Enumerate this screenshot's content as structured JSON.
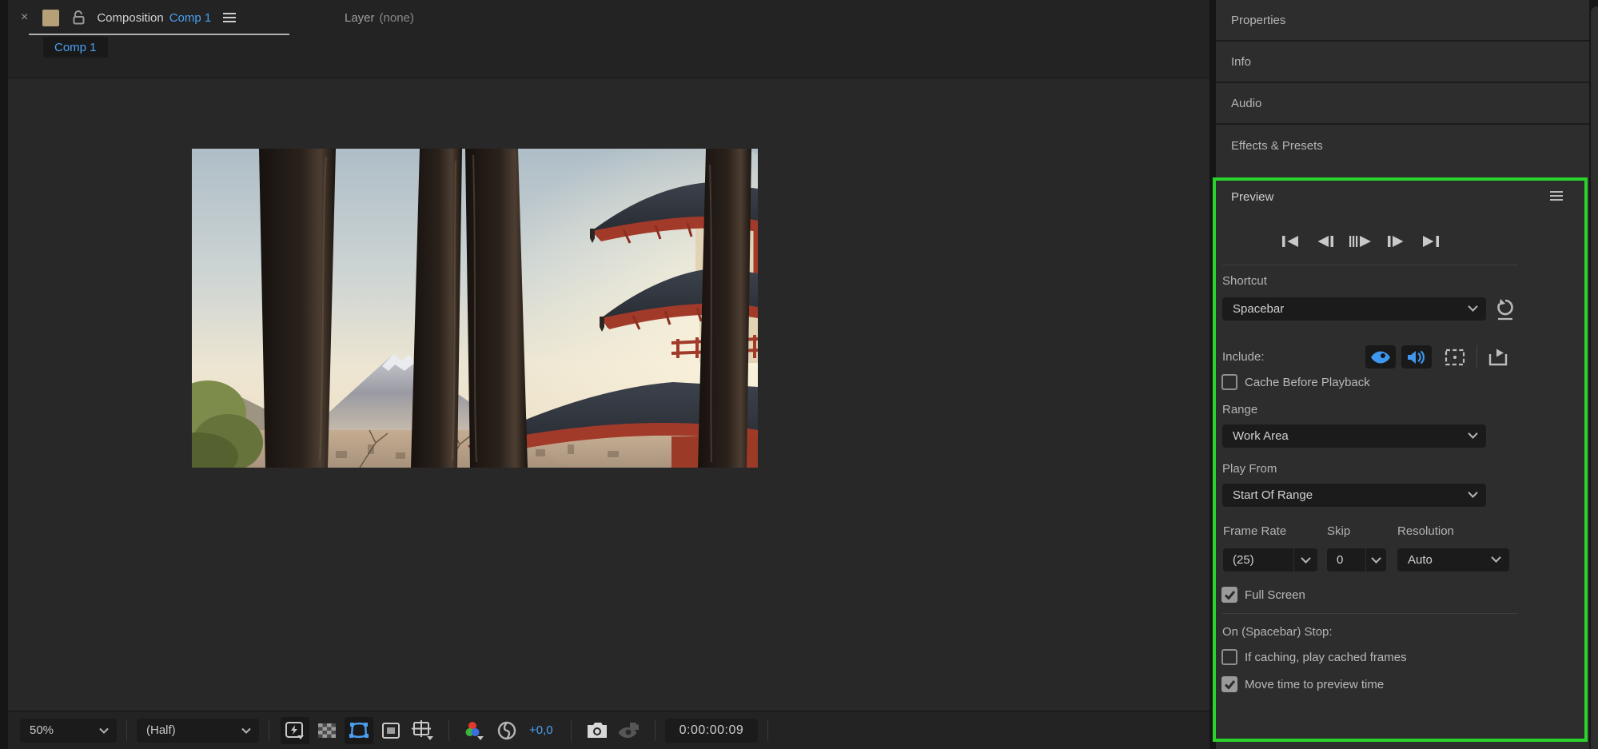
{
  "comp_panel": {
    "tabs": {
      "close_label": "×",
      "composition_tab": {
        "title": "Composition",
        "target": "Comp 1"
      },
      "layer_tab": {
        "title": "Layer",
        "target": "(none)"
      },
      "comp_button_label": "Comp 1"
    },
    "viewer": {
      "image_alt": "Red pagoda and Mount Fuji at dusk seen through dark fence slats"
    },
    "toolbar": {
      "zoom_value": "50%",
      "resolution_value": "(Half)",
      "exposure_value": "+0,0",
      "timecode": "0:00:00:09",
      "icons": [
        "fast-previews",
        "transparency-grid",
        "mask-visibility",
        "region-of-interest",
        "grid-guides",
        "channels",
        "exposure",
        "snapshot",
        "show-snapshot"
      ]
    }
  },
  "right_panel": {
    "sections": [
      {
        "label": "Properties"
      },
      {
        "label": "Info"
      },
      {
        "label": "Audio"
      },
      {
        "label": "Effects & Presets"
      }
    ],
    "preview": {
      "title": "Preview",
      "transport_icons": [
        "first-frame",
        "previous-frame",
        "play",
        "next-frame",
        "last-frame"
      ],
      "shortcut_label": "Shortcut",
      "shortcut_value": "Spacebar",
      "include_label": "Include:",
      "include_icons": [
        "video-eye",
        "audio-speaker",
        "overlays",
        "play-on-device"
      ],
      "cache_checkbox": {
        "label": "Cache Before Playback",
        "checked": false
      },
      "range_label": "Range",
      "range_value": "Work Area",
      "play_from_label": "Play From",
      "play_from_value": "Start Of Range",
      "frame_rate_label": "Frame Rate",
      "frame_rate_value": "(25)",
      "skip_label": "Skip",
      "skip_value": "0",
      "resolution_label": "Resolution",
      "resolution_value": "Auto",
      "full_screen_checkbox": {
        "label": "Full Screen",
        "checked": true
      },
      "on_stop_label": "On (Spacebar) Stop:",
      "if_caching_checkbox": {
        "label": "If caching, play cached frames",
        "checked": false
      },
      "move_time_checkbox": {
        "label": "Move time to preview time",
        "checked": true
      }
    },
    "highlight_color": "#2bd42b"
  }
}
